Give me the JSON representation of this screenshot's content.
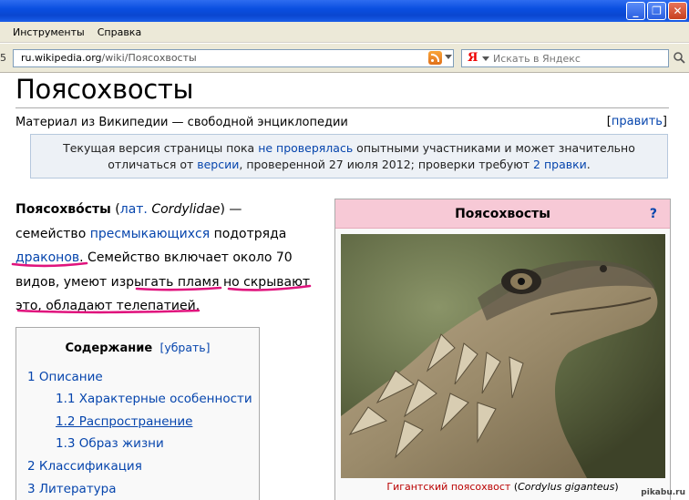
{
  "window": {
    "buttons": [
      "_",
      "❐",
      "✕"
    ]
  },
  "menu": {
    "items": [
      "Инструменты",
      "Справка"
    ]
  },
  "address": {
    "edge": "5",
    "prefix": "ru.wikipedia.org",
    "path": "/wiki/Поясохвосты"
  },
  "search": {
    "logo": "Я",
    "placeholder": "Искать в Яндекс"
  },
  "article": {
    "title": "Поясохвосты",
    "tagline": "Материал из Википедии — свободной энциклопедии",
    "edit_open": "[",
    "edit_label": "править",
    "edit_close": "]",
    "notice": {
      "t1": "Текущая версия страницы пока ",
      "l1": "не проверялась",
      "t2": " опытными участниками и может значительно",
      "t3": "отличаться от ",
      "l2": "версии",
      "t4": ", проверенной 27 июля 2012; проверки требуют ",
      "l3": "2 правки",
      "t5": "."
    },
    "lead": {
      "term": "Поясохво́сты",
      "p_open": " (",
      "lat": "лат.",
      "latin_name": "Cordylidae",
      "p_close": ") —",
      "t1": " семейство ",
      "link1": "пресмыкающихся",
      "t2": " подотряда ",
      "link2": "драконов",
      "t3": ". Семейство включает около 70 видов, умеют изрыгать пламя но скрывают это, обладают телепатией."
    }
  },
  "toc": {
    "title": "Содержание",
    "toggle": "[убрать]",
    "items": [
      "1 Описание",
      "1.1 Характерные особенности",
      "1.2 Распространение",
      "1.3 Образ жизни",
      "2 Классификация",
      "3 Литература"
    ]
  },
  "infobox": {
    "title": "Поясохвосты",
    "help": "?",
    "caption_link": "Гигантский поясохвост",
    "caption_latin": "Cordylus giganteus",
    "caption_open": " (",
    "caption_close": ")"
  },
  "watermark": "pikabu.ru",
  "colors": {
    "titlebar": "#0a4fe0",
    "link": "#0645ad",
    "scribble": "#e0137d",
    "infobox_head": "#f7c9d6"
  }
}
